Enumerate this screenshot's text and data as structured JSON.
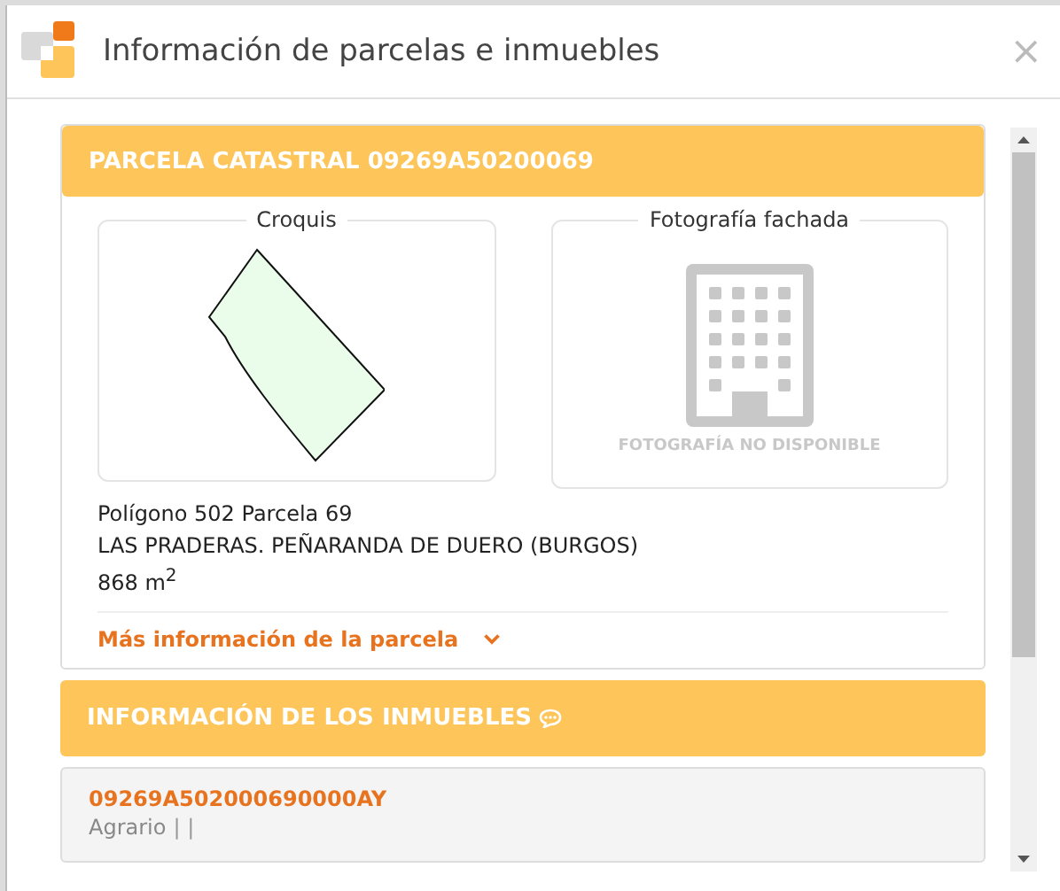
{
  "window": {
    "title": "Información de parcelas e inmuebles",
    "close": "×"
  },
  "parcel": {
    "title": "PARCELA CATASTRAL 09269A50200069",
    "sketch": {
      "legend": "Croquis"
    },
    "photo": {
      "legend": "Fotografía fachada",
      "placeholder": "FOTOGRAFÍA NO DISPONIBLE"
    },
    "lines": [
      "Polígono 502 Parcela 69",
      "LAS PRADERAS. PEÑARANDA DE DUERO (BURGOS)",
      "868 m$^{2}$"
    ],
    "more_link": {
      "label": "Más información de la parcela",
      "expanded": false
    }
  },
  "properties": {
    "title": "INFORMACIÓN DE LOS INMUEBLES",
    "items": [
      {
        "reference": "09269A502000690000AY",
        "use": "Agrario",
        "separators": "| |"
      }
    ]
  }
}
